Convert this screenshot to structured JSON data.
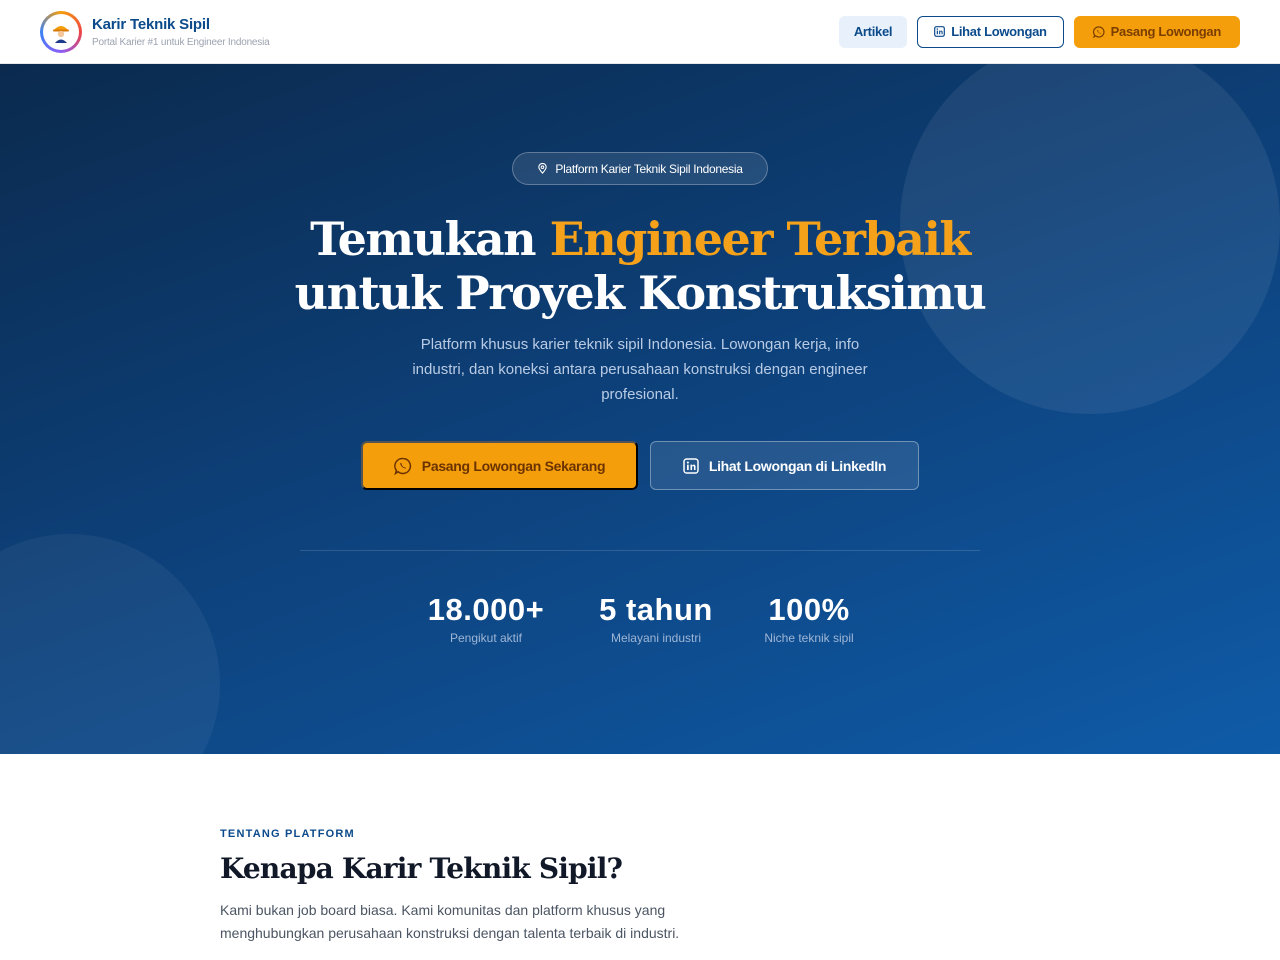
{
  "header": {
    "brand_title": "Karir Teknik Sipil",
    "brand_subtitle": "Portal Karier #1 untuk Engineer Indonesia",
    "nav": {
      "artikel": "Artikel",
      "lihat_lowongan": "Lihat Lowongan",
      "pasang_lowongan": "Pasang Lowongan"
    }
  },
  "hero": {
    "badge": "Platform Karier Teknik Sipil Indonesia",
    "headline_pre": "Temukan ",
    "headline_accent": "Engineer Terbaik",
    "headline_line2": "untuk Proyek Konstruksimu",
    "description": "Platform khusus karier teknik sipil Indonesia. Lowongan kerja, info industri, dan koneksi antara perusahaan konstruksi dengan engineer profesional.",
    "cta_primary": "Pasang Lowongan Sekarang",
    "cta_secondary": "Lihat Lowongan di LinkedIn",
    "stats": [
      {
        "value": "18.000+",
        "label": "Pengikut aktif"
      },
      {
        "value": "5 tahun",
        "label": "Melayani industri"
      },
      {
        "value": "100%",
        "label": "Niche teknik sipil"
      }
    ]
  },
  "about": {
    "eyebrow": "TENTANG PLATFORM",
    "title": "Kenapa Karir Teknik Sipil?",
    "description": "Kami bukan job board biasa. Kami komunitas dan platform khusus yang menghubungkan perusahaan konstruksi dengan talenta terbaik di industri."
  },
  "colors": {
    "brand_blue": "#0b4a8b",
    "accent_orange": "#f59e0b",
    "hero_dark": "#0b2a4e",
    "hero_light": "#0f5ba8"
  },
  "icons": {
    "logo": "engineer-mascot-logo",
    "location": "location-pin-icon",
    "linkedin": "linkedin-icon",
    "whatsapp": "whatsapp-icon"
  }
}
